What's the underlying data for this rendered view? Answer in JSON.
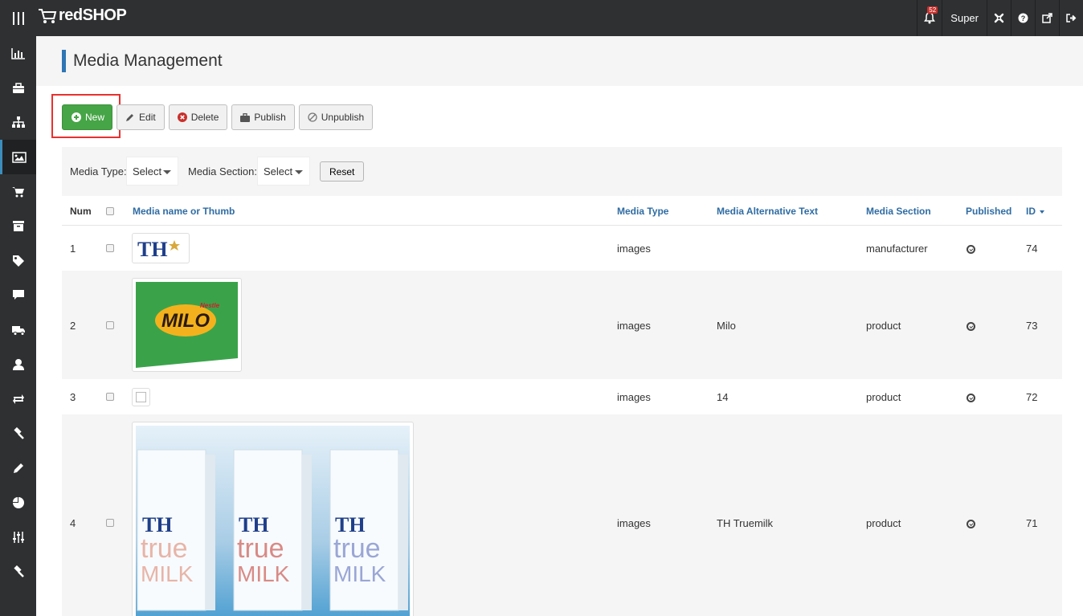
{
  "app": {
    "logo_text": "redSHOP"
  },
  "topbar": {
    "notifications_count": "52",
    "user_label": "Super"
  },
  "page": {
    "title": "Media Management"
  },
  "toolbar": {
    "new_label": "New",
    "edit_label": "Edit",
    "delete_label": "Delete",
    "publish_label": "Publish",
    "unpublish_label": "Unpublish"
  },
  "filters": {
    "media_type_label": "Media Type:",
    "media_type_value": "Select",
    "media_section_label": "Media Section:",
    "media_section_value": "Select",
    "reset_label": "Reset"
  },
  "table": {
    "headers": {
      "num": "Num",
      "name": "Media name or Thumb",
      "type": "Media Type",
      "alt": "Media Alternative Text",
      "section": "Media Section",
      "published": "Published",
      "id": "ID"
    },
    "rows": [
      {
        "num": "1",
        "type": "images",
        "alt": "",
        "section": "manufacturer",
        "id": "74",
        "thumb": "TH logo"
      },
      {
        "num": "2",
        "type": "images",
        "alt": "Milo",
        "section": "product",
        "id": "73",
        "thumb": "Milo"
      },
      {
        "num": "3",
        "type": "images",
        "alt": "14",
        "section": "product",
        "id": "72",
        "thumb": ""
      },
      {
        "num": "4",
        "type": "images",
        "alt": "TH Truemilk",
        "section": "product",
        "id": "71",
        "thumb": "TH true MILK"
      }
    ]
  },
  "thumbs": {
    "th_logo_text": "TH",
    "milo_brand": "Nestle",
    "milo_text": "MILO",
    "truemilk_th": "TH",
    "truemilk_true": "true",
    "truemilk_milk": "MILK"
  },
  "colors": {
    "accent": "#2f76b4",
    "new_button": "#46a546",
    "highlight": "#e8312f",
    "sidebar": "#2e3032"
  }
}
